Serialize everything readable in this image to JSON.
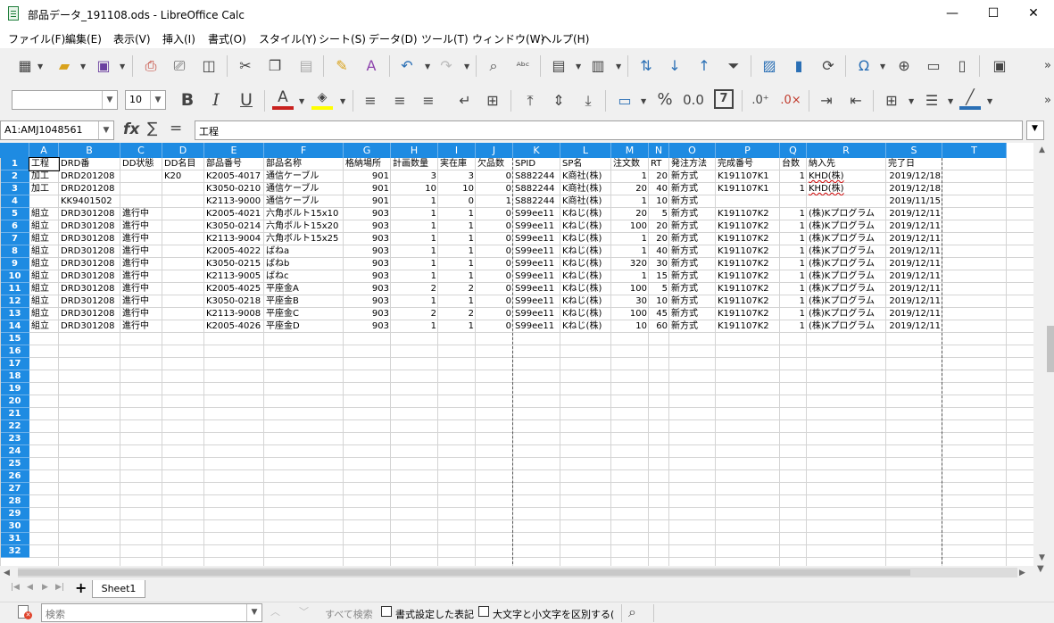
{
  "window": {
    "title": "部品データ_191108.ods - LibreOffice Calc",
    "minimize_glyph": "—",
    "maximize_glyph": "☐",
    "close_glyph": "✕"
  },
  "menu": [
    "ファイル(F)",
    "編集(E)",
    "表示(V)",
    "挿入(I)",
    "書式(O)",
    "スタイル(Y)",
    "シート(S)",
    "データ(D)",
    "ツール(T)",
    "ウィンドウ(W)",
    "ヘルプ(H)"
  ],
  "format_toolbar": {
    "font_name": "",
    "font_size": "10",
    "bold": "B",
    "italic": "I",
    "underline": "U",
    "percent": "%",
    "decimal": "0.0"
  },
  "formula_bar": {
    "name_box": "A1:AMJ1048561",
    "fx": "fx",
    "sum": "∑",
    "equals": "=",
    "content": "工程"
  },
  "columns": [
    "A",
    "B",
    "C",
    "D",
    "E",
    "F",
    "G",
    "H",
    "I",
    "J",
    "K",
    "L",
    "M",
    "N",
    "O",
    "P",
    "Q",
    "R",
    "S",
    "T"
  ],
  "rows": [
    "1",
    "2",
    "3",
    "4",
    "5",
    "6",
    "7",
    "8",
    "9",
    "10",
    "11",
    "12",
    "13",
    "14",
    "15",
    "16",
    "17",
    "18",
    "19",
    "20",
    "21",
    "22",
    "23",
    "24",
    "25",
    "26",
    "27",
    "28",
    "29",
    "30",
    "31",
    "32"
  ],
  "cells": [
    [
      "工程",
      "DRD番",
      "DD状態",
      "DD名目",
      "部品番号",
      "部品名称",
      "格納場所",
      "計画数量",
      "実在庫",
      "欠品数",
      "SPID",
      "SP名",
      "注文数",
      "RT",
      "発注方法",
      "完成番号",
      "台数",
      "納入先",
      "完了日"
    ],
    [
      "加工",
      "DRD201208",
      "",
      "K20",
      "K2005-4017",
      "通信ケーブル",
      "901",
      "3",
      "3",
      "0",
      "S882244",
      "K商社(株)",
      "1",
      "20",
      "新方式",
      "K191107K1",
      "1",
      "KHD(株)",
      "2019/12/18"
    ],
    [
      "加工",
      "DRD201208",
      "",
      "",
      "K3050-0210",
      "通信ケーブル",
      "901",
      "10",
      "10",
      "0",
      "S882244",
      "K商社(株)",
      "20",
      "40",
      "新方式",
      "K191107K1",
      "1",
      "KHD(株)",
      "2019/12/18"
    ],
    [
      "",
      "KK9401502",
      "",
      "",
      "K2113-9000",
      "通信ケーブル",
      "901",
      "1",
      "0",
      "1",
      "S882244",
      "K商社(株)",
      "1",
      "10",
      "新方式",
      "",
      "",
      "",
      "2019/11/15"
    ],
    [
      "組立",
      "DRD301208",
      "進行中",
      "",
      "K2005-4021",
      "六角ボルト15x10",
      "903",
      "1",
      "1",
      "0",
      "S99ee11",
      "Kねじ(株)",
      "20",
      "5",
      "新方式",
      "K191107K2",
      "1",
      "(株)Kプログラム",
      "2019/12/11"
    ],
    [
      "組立",
      "DRD301208",
      "進行中",
      "",
      "K3050-0214",
      "六角ボルト15x20",
      "903",
      "1",
      "1",
      "0",
      "S99ee11",
      "Kねじ(株)",
      "100",
      "20",
      "新方式",
      "K191107K2",
      "1",
      "(株)Kプログラム",
      "2019/12/11"
    ],
    [
      "組立",
      "DRD301208",
      "進行中",
      "",
      "K2113-9004",
      "六角ボルト15x25",
      "903",
      "1",
      "1",
      "0",
      "S99ee11",
      "Kねじ(株)",
      "1",
      "20",
      "新方式",
      "K191107K2",
      "1",
      "(株)Kプログラム",
      "2019/12/11"
    ],
    [
      "組立",
      "DRD301208",
      "進行中",
      "",
      "K2005-4022",
      "ばねa",
      "903",
      "1",
      "1",
      "0",
      "S99ee11",
      "Kねじ(株)",
      "1",
      "40",
      "新方式",
      "K191107K2",
      "1",
      "(株)Kプログラム",
      "2019/12/11"
    ],
    [
      "組立",
      "DRD301208",
      "進行中",
      "",
      "K3050-0215",
      "ばねb",
      "903",
      "1",
      "1",
      "0",
      "S99ee11",
      "Kねじ(株)",
      "320",
      "30",
      "新方式",
      "K191107K2",
      "1",
      "(株)Kプログラム",
      "2019/12/11"
    ],
    [
      "組立",
      "DRD301208",
      "進行中",
      "",
      "K2113-9005",
      "ばねc",
      "903",
      "1",
      "1",
      "0",
      "S99ee11",
      "Kねじ(株)",
      "1",
      "15",
      "新方式",
      "K191107K2",
      "1",
      "(株)Kプログラム",
      "2019/12/11"
    ],
    [
      "組立",
      "DRD301208",
      "進行中",
      "",
      "K2005-4025",
      "平座金A",
      "903",
      "2",
      "2",
      "0",
      "S99ee11",
      "Kねじ(株)",
      "100",
      "5",
      "新方式",
      "K191107K2",
      "1",
      "(株)Kプログラム",
      "2019/12/11"
    ],
    [
      "組立",
      "DRD301208",
      "進行中",
      "",
      "K3050-0218",
      "平座金B",
      "903",
      "1",
      "1",
      "0",
      "S99ee11",
      "Kねじ(株)",
      "30",
      "10",
      "新方式",
      "K191107K2",
      "1",
      "(株)Kプログラム",
      "2019/12/11"
    ],
    [
      "組立",
      "DRD301208",
      "進行中",
      "",
      "K2113-9008",
      "平座金C",
      "903",
      "2",
      "2",
      "0",
      "S99ee11",
      "Kねじ(株)",
      "100",
      "45",
      "新方式",
      "K191107K2",
      "1",
      "(株)Kプログラム",
      "2019/12/11"
    ],
    [
      "組立",
      "DRD301208",
      "進行中",
      "",
      "K2005-4026",
      "平座金D",
      "903",
      "1",
      "1",
      "0",
      "S99ee11",
      "Kねじ(株)",
      "10",
      "60",
      "新方式",
      "K191107K2",
      "1",
      "(株)Kプログラム",
      "2019/12/11"
    ]
  ],
  "sheet_tabs": {
    "add_glyph": "+",
    "active": "Sheet1"
  },
  "find_bar": {
    "search_placeholder": "検索",
    "find_all": "すべて検索",
    "formatted_display": "書式設定した表記",
    "match_case": "大文字と小文字を区別する("
  }
}
